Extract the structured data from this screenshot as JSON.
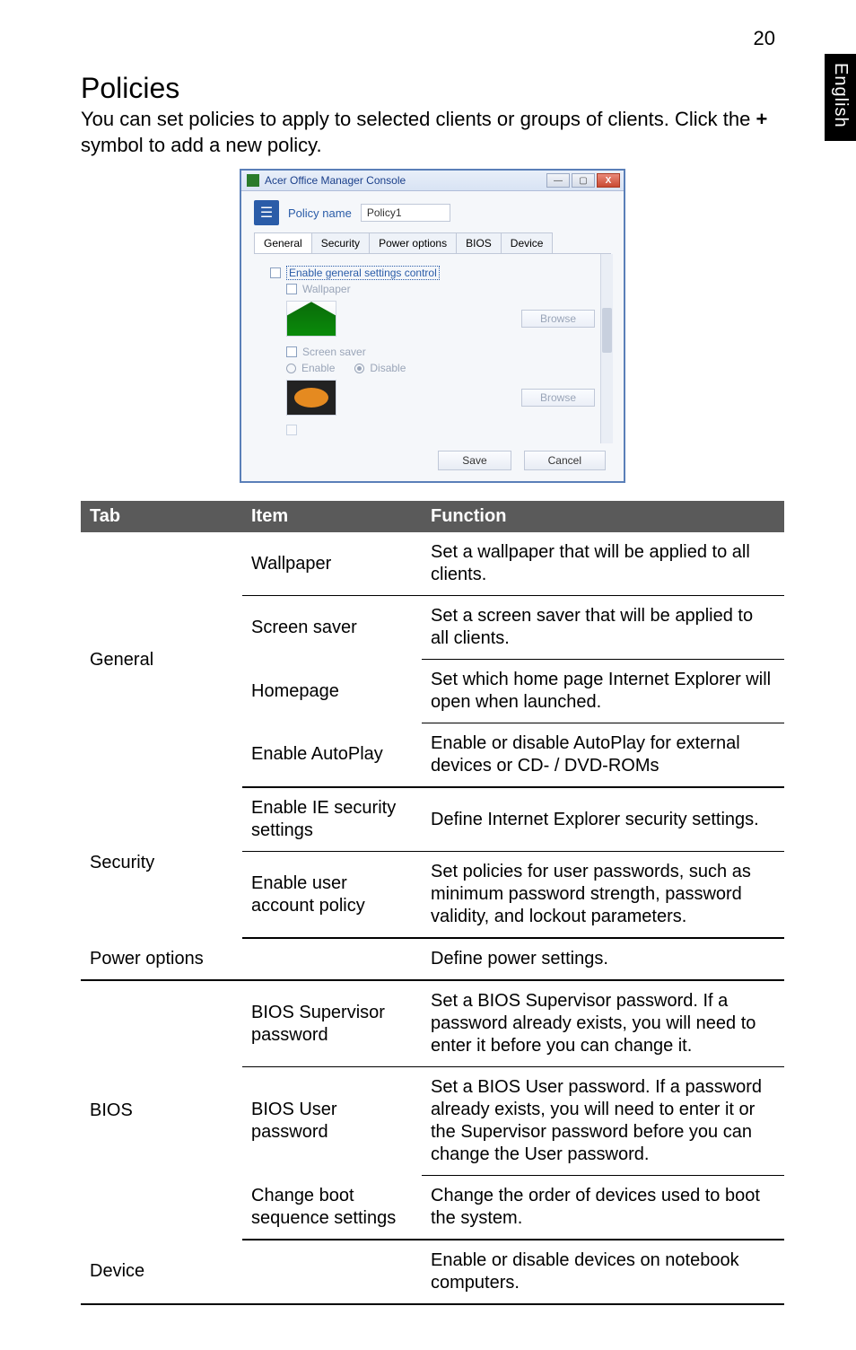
{
  "page_number": "20",
  "side_tab": "English",
  "section_title": "Policies",
  "intro_prefix": "You can set policies to apply to selected clients or groups of clients. Click the ",
  "intro_plus": "+",
  "intro_suffix": " symbol to add a new policy.",
  "dialog": {
    "window_title": "Acer Office Manager Console",
    "minimize_glyph": "—",
    "maximize_glyph": "▢",
    "close_glyph": "X",
    "policy_name_label": "Policy name",
    "policy_name_value": "Policy1",
    "tabs": {
      "general": "General",
      "security": "Security",
      "power": "Power options",
      "bios": "BIOS",
      "device": "Device"
    },
    "general_panel": {
      "enable_general_link": "Enable general settings control",
      "wallpaper_label": "Wallpaper",
      "browse1": "Browse",
      "screensaver_label": "Screen saver",
      "enable_label": "Enable",
      "disable_label": "Disable",
      "browse2": "Browse"
    },
    "footer": {
      "save": "Save",
      "cancel": "Cancel"
    }
  },
  "table": {
    "headers": {
      "tab": "Tab",
      "item": "Item",
      "function": "Function"
    },
    "groups": [
      {
        "tab": "General",
        "rows": [
          {
            "item": "Wallpaper",
            "function": "Set a wallpaper that will be applied to all clients."
          },
          {
            "item": "Screen saver",
            "function": "Set a screen saver that will be applied to all clients."
          },
          {
            "item": "Homepage",
            "function": "Set which home page Internet Explorer will open when launched."
          },
          {
            "item": "Enable AutoPlay",
            "function": "Enable or disable AutoPlay for external devices or CD- / DVD-ROMs"
          }
        ]
      },
      {
        "tab": "Security",
        "rows": [
          {
            "item": "Enable IE security settings",
            "function": "Define Internet Explorer security settings."
          },
          {
            "item": "Enable user account policy",
            "function": "Set policies for user passwords, such as minimum password strength, password validity, and lockout parameters."
          }
        ]
      },
      {
        "tab": "Power options",
        "rows": [
          {
            "item": "",
            "function": "Define power settings."
          }
        ]
      },
      {
        "tab": "BIOS",
        "rows": [
          {
            "item": "BIOS Supervisor password",
            "function": "Set a BIOS Supervisor password. If a password already exists, you will need to enter it before you can change it."
          },
          {
            "item": "BIOS User password",
            "function": "Set a BIOS User password. If a password already exists, you will need to enter it or the Supervisor password before you can change the User password."
          },
          {
            "item": "Change boot sequence settings",
            "function": "Change the order of devices used to boot the system."
          }
        ]
      },
      {
        "tab": "Device",
        "rows": [
          {
            "item": "",
            "function": "Enable or disable devices on notebook computers."
          }
        ]
      }
    ]
  }
}
